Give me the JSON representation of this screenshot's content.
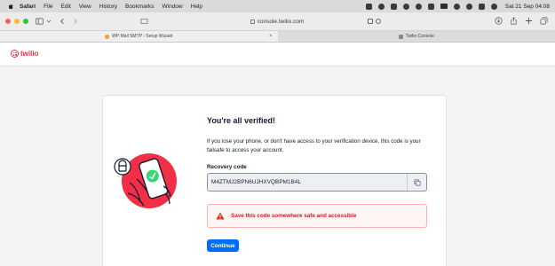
{
  "menubar": {
    "items": [
      "Safari",
      "File",
      "Edit",
      "View",
      "History",
      "Bookmarks",
      "Window",
      "Help"
    ],
    "clock": "Sat 21 Sep  04:08"
  },
  "browser": {
    "url": "console.twilio.com",
    "tabs": [
      {
        "label": "WP Mail SMTP › Setup Wizard",
        "active": true
      },
      {
        "label": "Twilio Console",
        "active": false
      }
    ]
  },
  "app": {
    "logo_text": "twilio",
    "brand_color": "#f22f46"
  },
  "verify": {
    "title": "You're all verified!",
    "description": "If you lose your phone, or don't have access to your verification device, this code is your failsafe to access your account.",
    "recovery_label": "Recovery code",
    "recovery_code": "M4ZTMJ2BPN6UJHXVQBPM1B4L",
    "warning": "Save this code somewhere safe and accessible",
    "continue_label": "Continue"
  },
  "icons": [
    "apple-icon",
    "sidebar-icon",
    "back-icon",
    "forward-icon",
    "lock-icon",
    "translate-icon",
    "reload-icon",
    "download-icon",
    "share-icon",
    "new-tab-icon",
    "tabs-overview-icon",
    "copy-icon",
    "warning-icon"
  ]
}
